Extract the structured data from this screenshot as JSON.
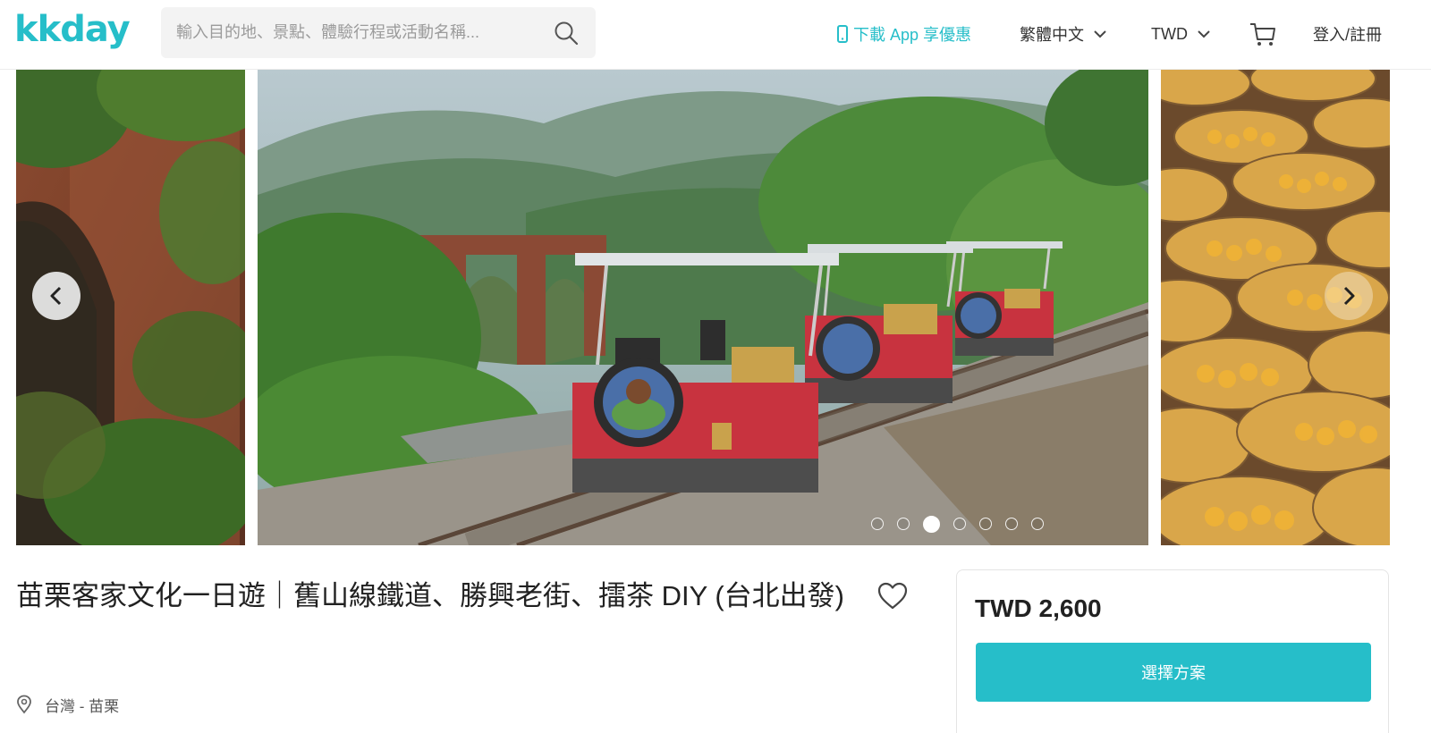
{
  "header": {
    "logo_text": "kkday",
    "search_placeholder": "輸入目的地、景點、體驗行程或活動名稱...",
    "app_link_label": "下載 App 享優惠",
    "language_label": "繁體中文",
    "currency_label": "TWD",
    "login_label": "登入/註冊"
  },
  "gallery": {
    "dot_count": 7,
    "active_dot_index": 2
  },
  "product": {
    "title": "苗栗客家文化一日遊｜舊山線鐵道、勝興老街、擂茶 DIY (台北出發)",
    "location": "台灣 - 苗栗"
  },
  "booking": {
    "price": "TWD 2,600",
    "select_label": "選擇方案"
  },
  "colors": {
    "brand": "#26bec9",
    "text": "#212121"
  },
  "icons": [
    "search-icon",
    "phone-icon",
    "chevron-down-icon",
    "cart-icon",
    "chevron-left-icon",
    "chevron-right-icon",
    "heart-icon",
    "location-pin-icon"
  ]
}
